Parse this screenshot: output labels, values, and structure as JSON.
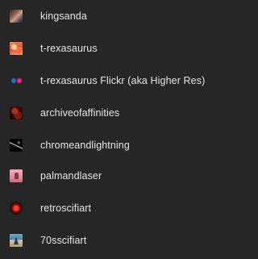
{
  "items": [
    {
      "label": "kingsanda",
      "icon": "kingsanda-thumbnail-icon"
    },
    {
      "label": "t-rexasaurus",
      "icon": "t-rexasaurus-thumbnail-icon"
    },
    {
      "label": "t-rexasaurus Flickr (aka Higher Res)",
      "icon": "flickr-icon"
    },
    {
      "label": "archiveofaffinities",
      "icon": "archiveofaffinities-thumbnail-icon"
    },
    {
      "label": "chromeandlightning",
      "icon": "chromeandlightning-thumbnail-icon"
    },
    {
      "label": "palmandlaser",
      "icon": "palmandlaser-thumbnail-icon"
    },
    {
      "label": "retroscifiart",
      "icon": "retroscifiart-thumbnail-icon"
    },
    {
      "label": "70sscifiart",
      "icon": "70sscifiart-thumbnail-icon"
    }
  ],
  "colors": {
    "background": "#262626",
    "text": "#e6e6e6",
    "flickr_blue": "#1a6ee0",
    "flickr_pink": "#ff1a8c"
  }
}
